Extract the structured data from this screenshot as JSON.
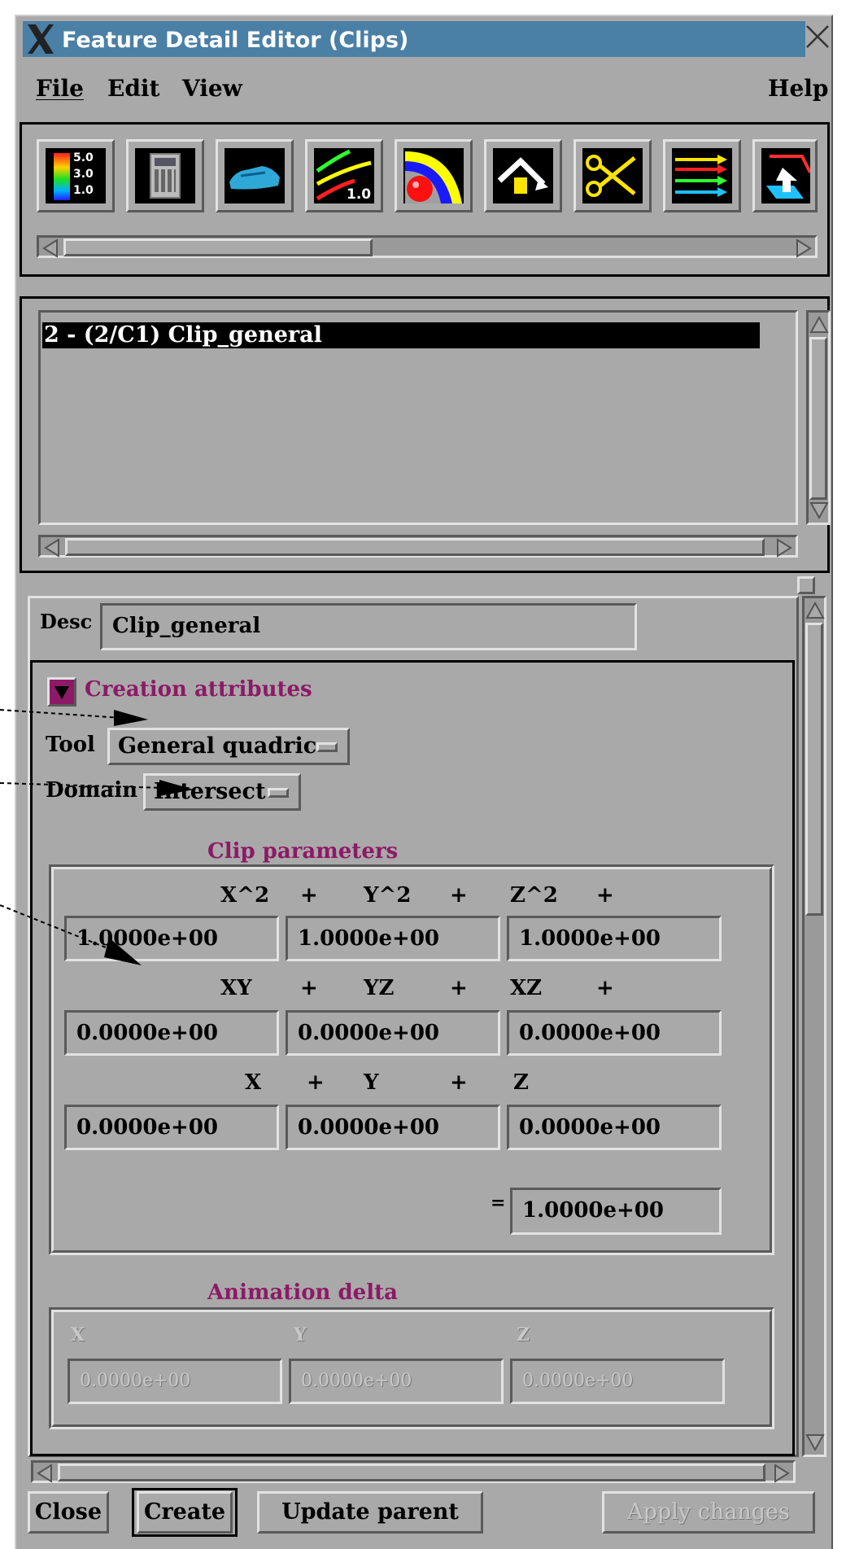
{
  "window": {
    "title": "Feature Detail Editor (Clips)"
  },
  "menu": {
    "file": "File",
    "edit": "Edit",
    "view": "View",
    "help": "Help"
  },
  "toolbar": {
    "icons": [
      "color-legend-icon",
      "calculator-icon",
      "car-model-icon",
      "contour-line-icon",
      "isosurface-icon",
      "elevate-icon",
      "clip-scissors-icon",
      "vector-arrows-icon",
      "extrude-icon"
    ],
    "legend_values": [
      "5.0",
      "3.0",
      "1.0"
    ],
    "contour_value": "1.0"
  },
  "part_list": {
    "items": [
      "2 - (2/C1) Clip_general"
    ],
    "selected": "2 - (2/C1) Clip_general"
  },
  "desc": {
    "label": "Desc",
    "value": "Clip_general"
  },
  "creation": {
    "header": "Creation attributes",
    "tool_label": "Tool",
    "tool_value": "General quadric",
    "domain_label": "Domain",
    "domain_value": "Intersect"
  },
  "clip_params": {
    "title": "Clip parameters",
    "row1_labels": [
      "X^2",
      "+",
      "Y^2",
      "+",
      "Z^2",
      "+"
    ],
    "row1_values": [
      "1.0000e+00",
      "1.0000e+00",
      "1.0000e+00"
    ],
    "row2_labels": [
      "XY",
      "+",
      "YZ",
      "+",
      "XZ",
      "+"
    ],
    "row2_values": [
      "0.0000e+00",
      "0.0000e+00",
      "0.0000e+00"
    ],
    "row3_labels": [
      "X",
      "+",
      "Y",
      "+",
      "Z"
    ],
    "row3_values": [
      "0.0000e+00",
      "0.0000e+00",
      "0.0000e+00"
    ],
    "equals": "=",
    "rhs_value": "1.0000e+00"
  },
  "animation": {
    "title": "Animation delta",
    "labels": [
      "X",
      "Y",
      "Z"
    ],
    "values": [
      "0.0000e+00",
      "0.0000e+00",
      "0.0000e+00"
    ]
  },
  "buttons": {
    "close": "Close",
    "create": "Create",
    "update_parent": "Update parent",
    "apply": "Apply changes"
  }
}
